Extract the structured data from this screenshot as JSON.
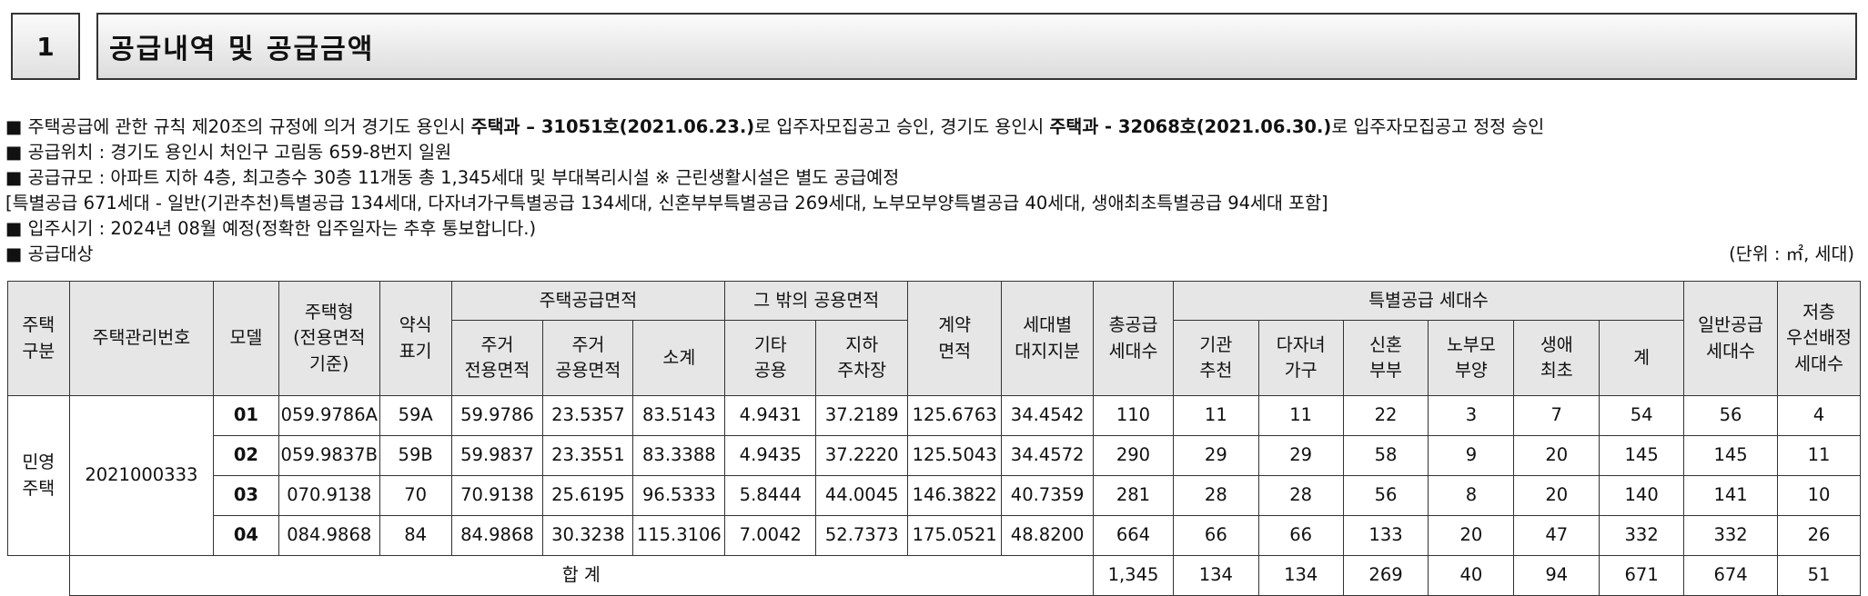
{
  "header": {
    "number": "1",
    "title": "공급내역 및 공급금액"
  },
  "notes": {
    "approval": {
      "prefix": "주택공급에 관한 규칙 제20조의 규정에 의거 경기도 용인시 ",
      "bold1": "주택과 – 31051호(2021.06.23.)",
      "middle": "로 입주자모집공고 승인, 경기도 용인시 ",
      "bold2": "주택과 - 32068호(2021.06.30.)",
      "suffix": "로 입주자모집공고 정정 승인"
    },
    "location": "공급위치 : 경기도 용인시 처인구 고림동 659-8번지 일원",
    "scale": "공급규모 : 아파트 지하 4층, 최고층수 30층 11개동 총 1,345세대 및 부대복리시설 ※ 근린생활시설은 별도 공급예정",
    "scale_detail": "[특별공급 671세대 - 일반(기관추천)특별공급 134세대, 다자녀가구특별공급 134세대, 신혼부부특별공급 269세대, 노부모부양특별공급 40세대, 생애최초특별공급 94세대 포함]",
    "move_in": "입주시기 : 2024년 08월 예정(정확한 입주일자는 추후 통보합니다.)",
    "target": "공급대상",
    "unit": "(단위 : ㎡, 세대)",
    "bullet": "■"
  },
  "table": {
    "h": {
      "housing_type": "주택\n구분",
      "mgmt_no": "주택관리번호",
      "model": "모델",
      "house_type": "주택형\n(전용면적\n기준)",
      "short": "약식\n표기",
      "supply_area": "주택공급면적",
      "other_area": "그 밖의 공용면적",
      "contract_area": "계약\n면적",
      "land_share": "세대별\n대지지분",
      "total_supply": "총공급\n세대수",
      "special": "특별공급 세대수",
      "general": "일반공급\n세대수",
      "low_floor": "저층\n우선배정\n세대수",
      "excl_area": "주거\n전용면적",
      "common_area": "주거\n공용면적",
      "subtotal": "소계",
      "etc_common": "기타\n공용",
      "parking": "지하\n주차장",
      "inst": "기관\n추천",
      "multi": "다자녀\n가구",
      "newlywed": "신혼\n부부",
      "parents": "노부모\n부양",
      "first": "생애\n최초",
      "sum": "계"
    },
    "category": "민영\n주택",
    "mgmt_no": "2021000333",
    "rows": [
      [
        "01",
        "059.9786A",
        "59A",
        "59.9786",
        "23.5357",
        "83.5143",
        "4.9431",
        "37.2189",
        "125.6763",
        "34.4542",
        "110",
        "11",
        "11",
        "22",
        "3",
        "7",
        "54",
        "56",
        "4"
      ],
      [
        "02",
        "059.9837B",
        "59B",
        "59.9837",
        "23.3551",
        "83.3388",
        "4.9435",
        "37.2220",
        "125.5043",
        "34.4572",
        "290",
        "29",
        "29",
        "58",
        "9",
        "20",
        "145",
        "145",
        "11"
      ],
      [
        "03",
        "070.9138",
        "70",
        "70.9138",
        "25.6195",
        "96.5333",
        "5.8444",
        "44.0045",
        "146.3822",
        "40.7359",
        "281",
        "28",
        "28",
        "56",
        "8",
        "20",
        "140",
        "141",
        "10"
      ],
      [
        "04",
        "084.9868",
        "84",
        "84.9868",
        "30.3238",
        "115.3106",
        "7.0042",
        "52.7373",
        "175.0521",
        "48.8200",
        "664",
        "66",
        "66",
        "133",
        "20",
        "47",
        "332",
        "332",
        "26"
      ]
    ],
    "total": {
      "label": "합 계",
      "values": [
        "1,345",
        "134",
        "134",
        "269",
        "40",
        "94",
        "671",
        "674",
        "51"
      ]
    }
  }
}
